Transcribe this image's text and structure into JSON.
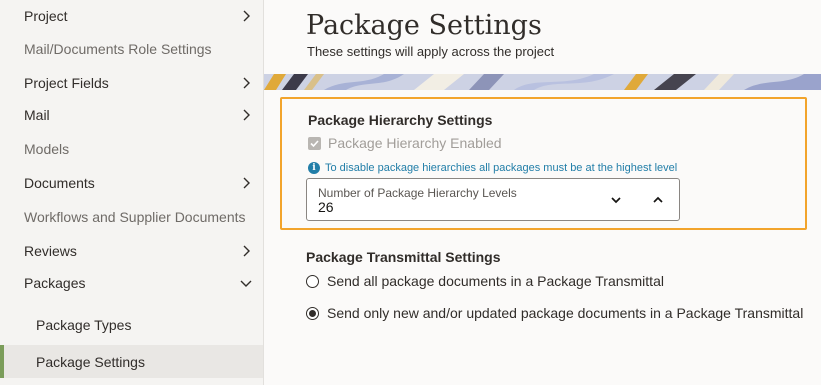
{
  "sidebar": {
    "items": [
      {
        "label": "Project",
        "chevron": "chevron-right"
      },
      {
        "label": "Mail/Documents Role Settings",
        "chevron": null
      },
      {
        "label": "Project Fields",
        "chevron": "chevron-right"
      },
      {
        "label": "Mail",
        "chevron": "chevron-right"
      },
      {
        "label": "Models",
        "chevron": null
      },
      {
        "label": "Documents",
        "chevron": "chevron-right"
      },
      {
        "label": "Workflows and Supplier Documents",
        "chevron": null
      },
      {
        "label": "Reviews",
        "chevron": "chevron-right"
      },
      {
        "label": "Packages",
        "chevron": "chevron-down"
      },
      {
        "label": "Package Types",
        "chevron": null
      },
      {
        "label": "Package Settings",
        "chevron": null,
        "selected": true
      }
    ]
  },
  "main": {
    "title": "Package Settings",
    "subtitle": "These settings will apply across the project",
    "hierarchy": {
      "title": "Package Hierarchy Settings",
      "checkbox_label": "Package Hierarchy Enabled",
      "checkbox_checked": true,
      "info_text": "To disable package hierarchies all packages must be at the highest level",
      "info_icon": "info-icon",
      "stepper_label": "Number of Package Hierarchy Levels",
      "stepper_value": "26"
    },
    "transmittal": {
      "title": "Package Transmittal Settings",
      "options": [
        {
          "label": "Send all package documents in a Package Transmittal",
          "selected": false
        },
        {
          "label": "Send only new and/or updated package documents in a Package Transmittal",
          "selected": true
        }
      ]
    }
  },
  "colors": {
    "highlight_border": "#f2a42c",
    "selected_indicator": "#7b9d5a",
    "info": "#227ea8"
  }
}
